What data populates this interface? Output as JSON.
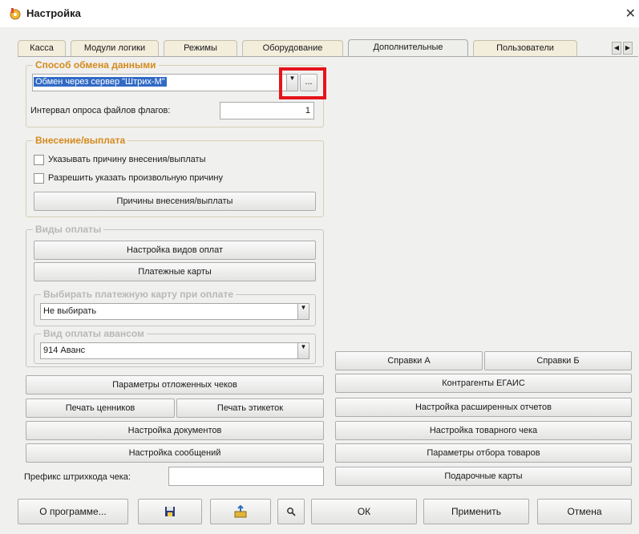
{
  "window": {
    "title": "Настройка",
    "close": "✕"
  },
  "tabs": [
    {
      "label": "Касса"
    },
    {
      "label": "Модули логики"
    },
    {
      "label": "Режимы"
    },
    {
      "label": "Оборудование"
    },
    {
      "label": "Дополнительные"
    },
    {
      "label": "Пользователи"
    }
  ],
  "active_tab": "Дополнительные",
  "exchange": {
    "legend": "Способ обмена данными",
    "method_value": "Обмен через сервер \"Штрих-М\"",
    "select_button": "...",
    "interval_label": "Интервал опроса файлов флагов:",
    "interval_value": "1"
  },
  "cash": {
    "legend": "Внесение/выплата",
    "cb_reason_label": "Указывать причину внесения/выплаты",
    "cb_custom_label": "Разрешить указать произвольную причину",
    "reasons_button": "Причины внесения/выплаты"
  },
  "payments": {
    "legend": "Виды оплаты",
    "setup_button": "Настройка видов оплат",
    "cards_button": "Платежные карты",
    "choose_card": {
      "legend": "Выбирать платежную карту при оплате",
      "value": "Не выбирать"
    },
    "advance": {
      "legend": "Вид оплаты авансом",
      "value": "914 Аванс"
    }
  },
  "left_buttons": {
    "deferred": "Параметры отложенных чеков",
    "price_tags": "Печать ценников",
    "labels": "Печать этикеток",
    "documents": "Настройка документов",
    "messages": "Настройка сообщений"
  },
  "barcode_prefix": {
    "label": "Префикс штрихкода чека:",
    "value": ""
  },
  "right_buttons": {
    "refA": "Справки А",
    "refB": "Справки Б",
    "egais": "Контрагенты ЕГАИС",
    "reports": "Настройка расширенных отчетов",
    "receipt": "Настройка товарного чека",
    "filter": "Параметры отбора товаров",
    "giftcards": "Подарочные карты"
  },
  "bottom": {
    "about": "О программе...",
    "ok": "ОК",
    "apply": "Применить",
    "cancel": "Отмена"
  }
}
